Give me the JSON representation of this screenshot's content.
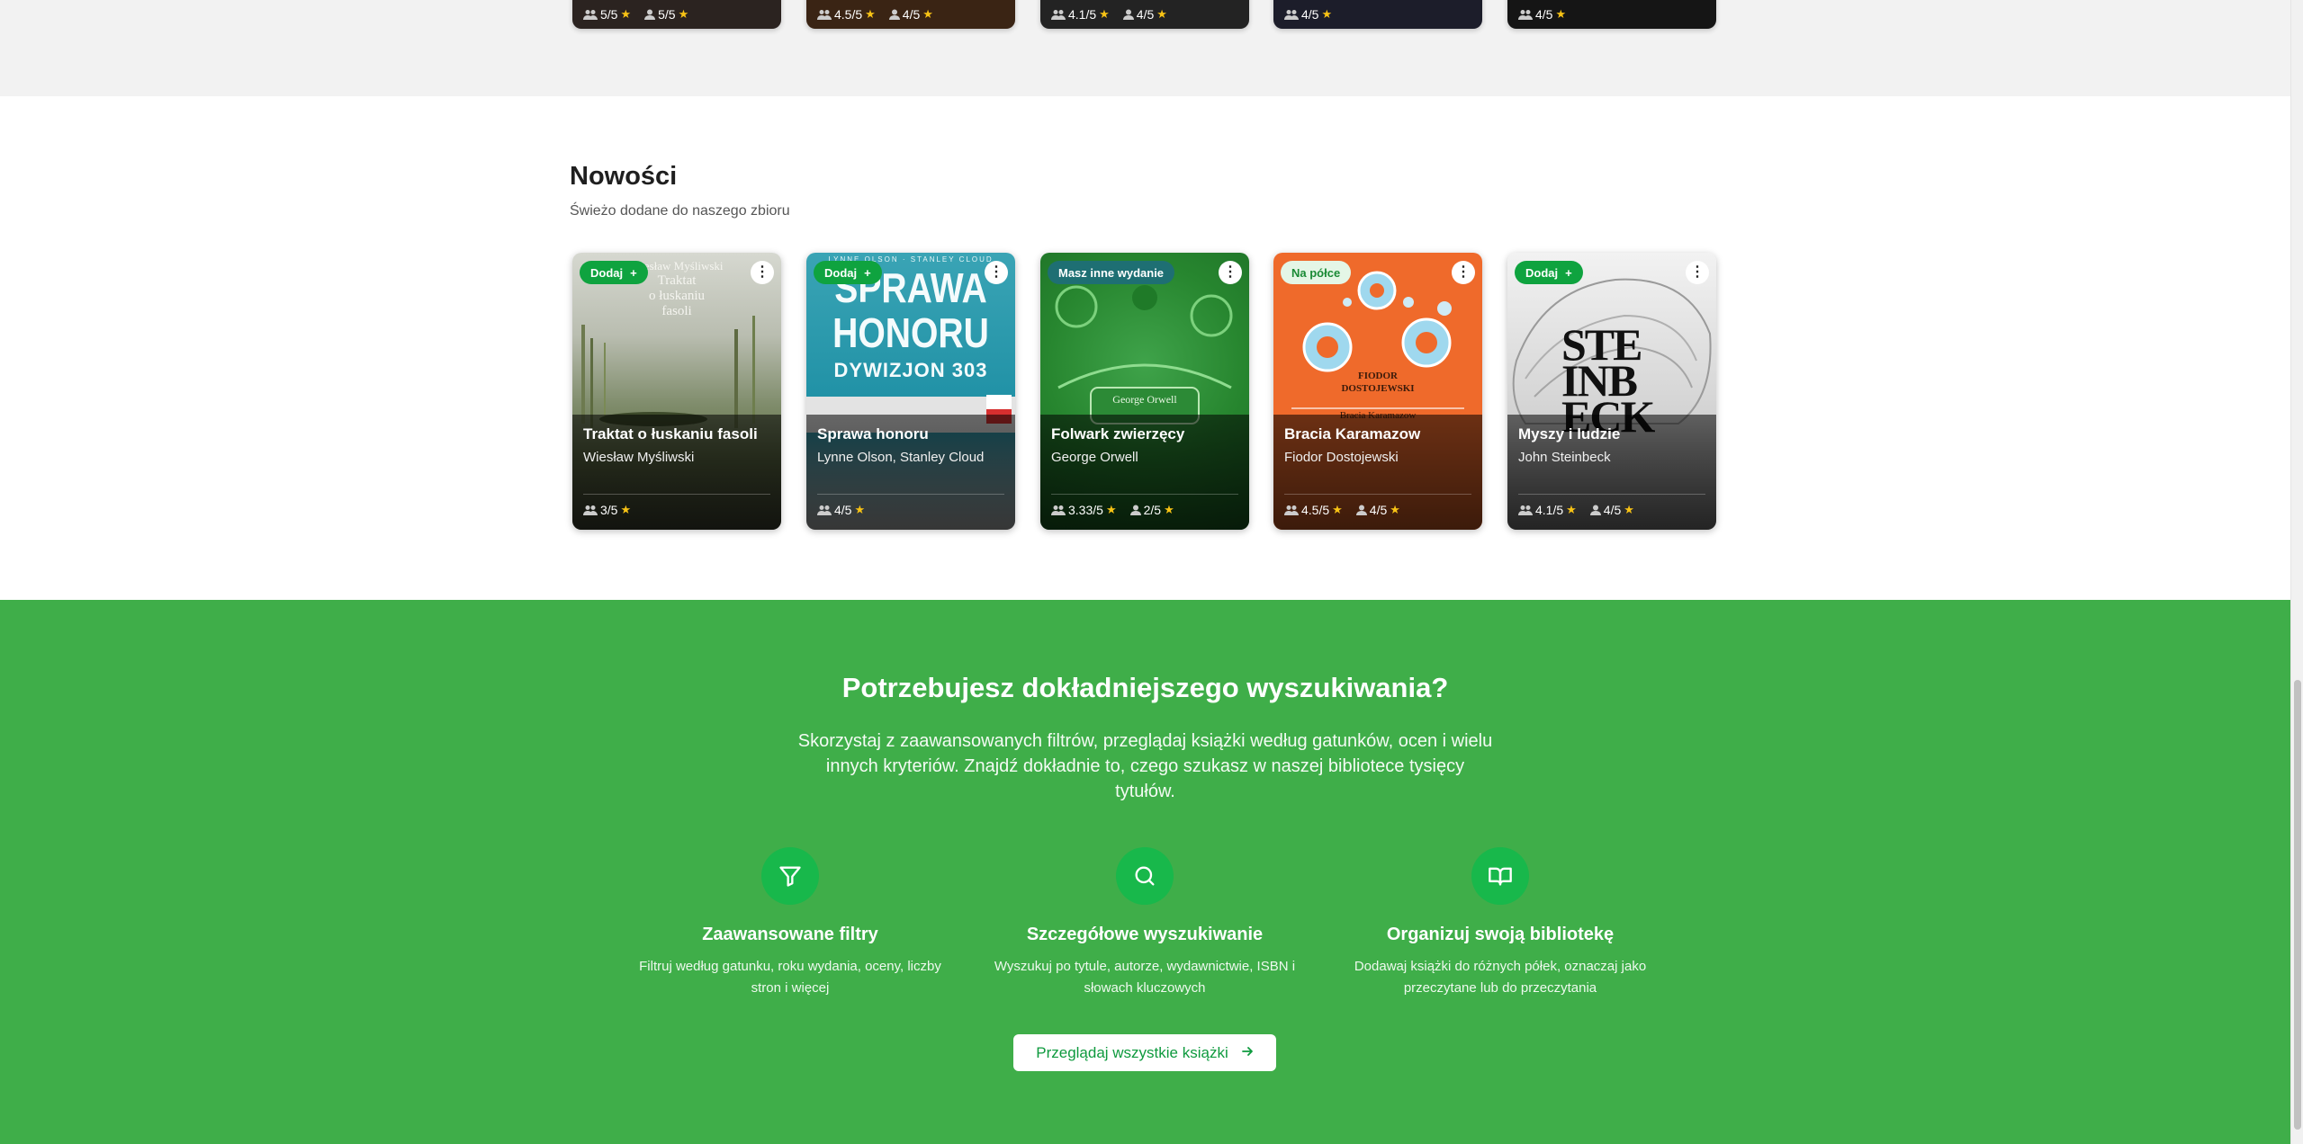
{
  "top_cards": [
    {
      "community": "5/5",
      "user": "5/5"
    },
    {
      "community": "4.5/5",
      "user": "4/5"
    },
    {
      "community": "4.1/5",
      "user": "4/5"
    },
    {
      "community": "4/5",
      "user": ""
    },
    {
      "community": "4/5",
      "user": ""
    }
  ],
  "new_section": {
    "title": "Nowości",
    "subtitle": "Świeżo dodane do naszego zbioru"
  },
  "books": [
    {
      "title": "Traktat o łuskaniu fasoli",
      "author": "Wiesław Myśliwski",
      "badge": "Dodaj",
      "badge_type": "add",
      "community": "3/5",
      "user": "",
      "cover_lines": [
        "Wiesław Myśliwski",
        "Traktat",
        "o łuskaniu",
        "fasoli"
      ]
    },
    {
      "title": "Sprawa honoru",
      "author": "Lynne Olson, Stanley Cloud",
      "badge": "Dodaj",
      "badge_type": "add",
      "community": "4/5",
      "user": "",
      "cover_lines": [
        "LYNNE OLSON · STANLEY CLOUD",
        "SPRAWA",
        "HONORU",
        "DYWIZJON 303"
      ]
    },
    {
      "title": "Folwark zwierzęcy",
      "author": "George Orwell",
      "badge": "Masz inne wydanie",
      "badge_type": "edition",
      "community": "3.33/5",
      "user": "2/5",
      "cover_lines": [
        "George Orwell"
      ]
    },
    {
      "title": "Bracia Karamazow",
      "author": "Fiodor Dostojewski",
      "badge": "Na półce",
      "badge_type": "shelf",
      "community": "4.5/5",
      "user": "4/5",
      "cover_lines": [
        "FIODOR",
        "DOSTOJEWSKI",
        "Bracia Karamazow"
      ]
    },
    {
      "title": "Myszy i ludzie",
      "author": "John Steinbeck",
      "badge": "Dodaj",
      "badge_type": "add",
      "community": "4.1/5",
      "user": "4/5",
      "cover_lines": [
        "STE",
        "INB",
        "ECK"
      ]
    }
  ],
  "menu_glyph": "⋮",
  "star_glyph": "★",
  "promo": {
    "title": "Potrzebujesz dokładniejszego wyszukiwania?",
    "text": "Skorzystaj z zaawansowanych filtrów, przeglądaj książki według gatunków, ocen i wielu innych kryteriów. Znajdź dokładnie to, czego szukasz w naszej bibliotece tysięcy tytułów.",
    "features": [
      {
        "icon": "filter-icon",
        "title": "Zaawansowane filtry",
        "desc": "Filtruj według gatunku, roku wydania, oceny, liczby stron i więcej"
      },
      {
        "icon": "search-icon",
        "title": "Szczegółowe wyszukiwanie",
        "desc": "Wyszukuj po tytule, autorze, wydawnictwie, ISBN i słowach kluczowych"
      },
      {
        "icon": "book-open-icon",
        "title": "Organizuj swoją bibliotekę",
        "desc": "Dodawaj książki do różnych półek, oznaczaj jako przeczytane lub do przeczytania"
      }
    ],
    "button": "Przeglądaj wszystkie książki"
  },
  "colors": {
    "promo_bg": "#3fae49",
    "accent_green": "#0fa33f",
    "star": "#f8c315",
    "edition_badge": "#1e6f73"
  }
}
